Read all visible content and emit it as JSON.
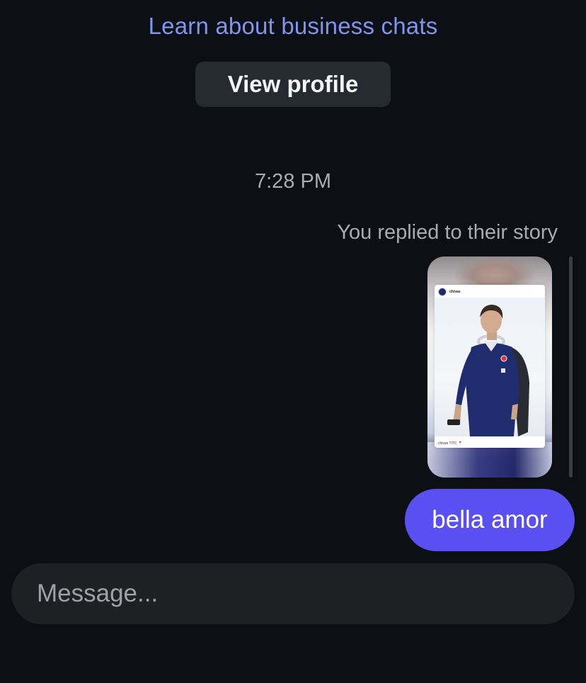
{
  "header": {
    "learn_link": "Learn about business chats",
    "view_profile_label": "View profile"
  },
  "thread": {
    "timestamp": "7:28 PM",
    "reply_note": "You replied to their story",
    "story": {
      "username": "chivas",
      "caption": "chivas TITC 📍"
    },
    "messages": [
      {
        "from": "me",
        "text": "bella amor"
      }
    ]
  },
  "composer": {
    "placeholder": "Message...",
    "value": ""
  },
  "colors": {
    "background": "#0c0f14",
    "link": "#7e95f2",
    "bubble": "#5a4ff0",
    "button": "#262a31",
    "composer": "#1f2024"
  }
}
